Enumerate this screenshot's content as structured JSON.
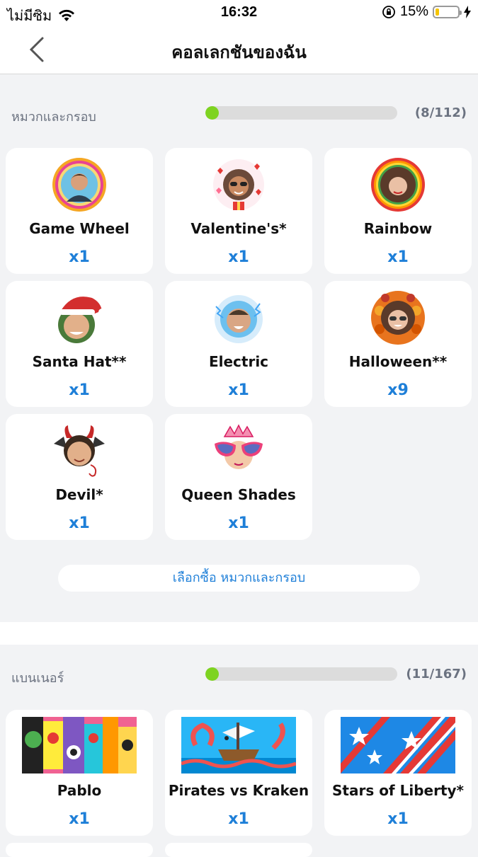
{
  "status_bar": {
    "carrier": "ไม่มีซิม",
    "time": "16:32",
    "battery_text": "15%",
    "battery_level": 0.15,
    "icons": [
      "wifi-icon",
      "orientation-lock-icon",
      "battery-icon",
      "charging-bolt-icon"
    ]
  },
  "nav": {
    "title": "คอลเลกชันของฉัน",
    "back_icon": "chevron-left-icon"
  },
  "frames_section": {
    "title": "หมวกและกรอบ",
    "count_text": "(8/112)",
    "progress": 0.0714,
    "items": [
      {
        "name": "Game Wheel",
        "qty": "x1"
      },
      {
        "name": "Valentine's*",
        "qty": "x1"
      },
      {
        "name": "Rainbow",
        "qty": "x1"
      },
      {
        "name": "Santa Hat**",
        "qty": "x1"
      },
      {
        "name": "Electric",
        "qty": "x1"
      },
      {
        "name": "Halloween**",
        "qty": "x9"
      },
      {
        "name": "Devil*",
        "qty": "x1"
      },
      {
        "name": "Queen Shades",
        "qty": "x1"
      }
    ],
    "shop_button": "เลือกซื้อ หมวกและกรอบ"
  },
  "banners_section": {
    "title": "แบนเนอร์",
    "count_text": "(11/167)",
    "progress": 0.0659,
    "items": [
      {
        "name": "Pablo",
        "qty": "x1"
      },
      {
        "name": "Pirates vs Kraken",
        "qty": "x1"
      },
      {
        "name": "Stars of Liberty*",
        "qty": "x1"
      }
    ]
  },
  "colors": {
    "accent": "#1e7fd8",
    "progress_fill": "#7ed321",
    "progress_track": "#dcdcdc",
    "background": "#f2f3f5",
    "battery": "#f5c400"
  }
}
